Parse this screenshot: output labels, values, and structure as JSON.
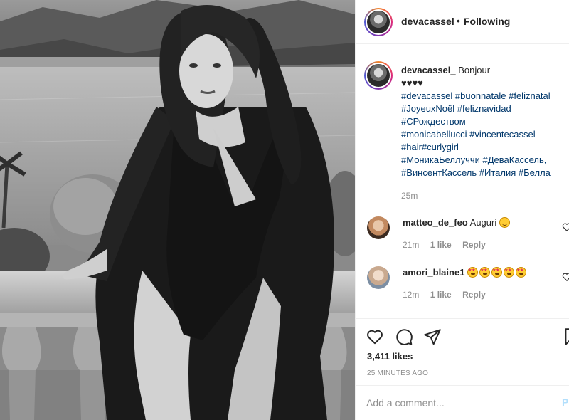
{
  "post": {
    "author": "devacassel_",
    "follow_status": "Following",
    "separator": "•",
    "caption": {
      "text": "Bonjour",
      "hearts": "♥♥♥♥",
      "lines": [
        [
          "#devacassel",
          "#buonnatale",
          "#feliznatal"
        ],
        [
          "#JoyeuxNoël",
          "#feliznavidad"
        ],
        [
          "#СРождеством"
        ],
        [
          "#monicabellucci",
          "#vincentecassel"
        ],
        [
          "#hair#curlygirl"
        ],
        [
          "#МоникаБеллуччи",
          "#ДеваКассель,"
        ],
        [
          "#ВинсентКассель",
          "#Италия",
          "#Белла"
        ]
      ],
      "time": "25m"
    },
    "comments": [
      {
        "user": "matteo_de_feo",
        "text": "Auguri",
        "emoji": "smile",
        "time": "21m",
        "likes": "1 like",
        "reply": "Reply"
      },
      {
        "user": "amori_blaine1",
        "text": "",
        "emoji": "starry-x5",
        "time": "12m",
        "likes": "1 like",
        "reply": "Reply"
      }
    ],
    "likes": "3,411 likes",
    "posted_ago": "25 MINUTES AGO",
    "add_comment_placeholder": "Add a comment...",
    "post_button": "Post"
  },
  "icons": {
    "like": "heart-outline-icon",
    "comment": "speech-bubble-icon",
    "share": "paper-plane-icon",
    "save": "bookmark-icon",
    "comment_like": "small-heart-icon"
  },
  "colors": {
    "hashtag": "#00376b",
    "muted": "#8e8e8e",
    "post_button": "#b2dffc",
    "divider": "#efefef"
  }
}
